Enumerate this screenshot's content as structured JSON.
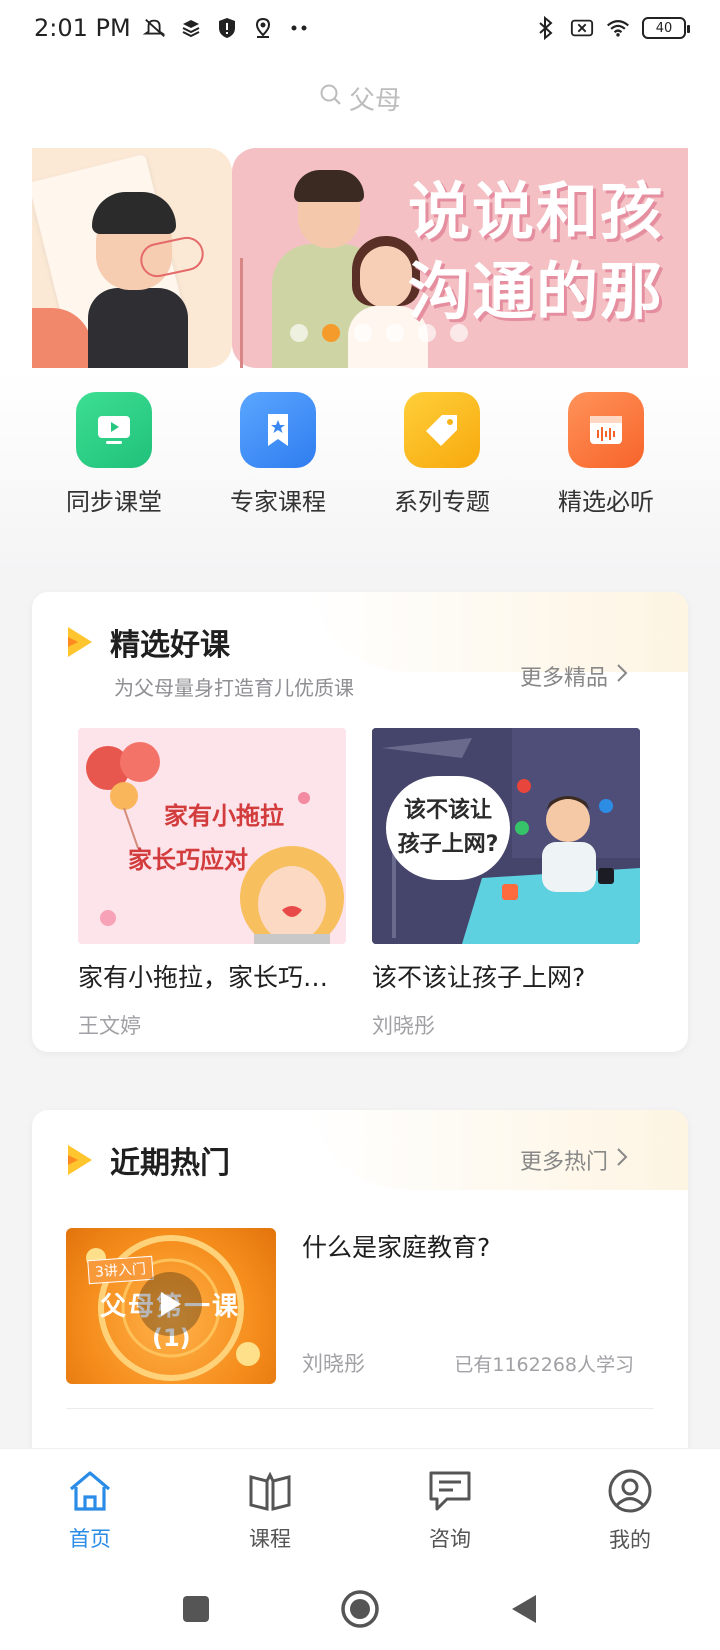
{
  "status_bar": {
    "time": "2:01 PM",
    "battery": "40",
    "left_icons": [
      "mute-icon",
      "layers-icon",
      "shield-icon",
      "location-icon",
      "more-dots-icon"
    ],
    "right_icons": [
      "bluetooth-icon",
      "no-sim-icon",
      "wifi-icon",
      "battery-icon"
    ]
  },
  "search": {
    "placeholder": "父母"
  },
  "banner": {
    "title_line1": "说说和孩",
    "title_line2": "沟通的那",
    "dot_count": 6,
    "active_dot": 1
  },
  "quick_entries": [
    {
      "label": "同步课堂",
      "icon": "tv-icon",
      "color": "#2ecf86"
    },
    {
      "label": "专家课程",
      "icon": "bookmark-star-icon",
      "color": "#3f8ff5"
    },
    {
      "label": "系列专题",
      "icon": "tag-icon",
      "color": "#f9b919"
    },
    {
      "label": "精选必听",
      "icon": "audio-window-icon",
      "color": "#fb7a3a"
    }
  ],
  "featured": {
    "title": "精选好课",
    "subtitle": "为父母量身打造育儿优质课",
    "more": "更多精品",
    "courses": [
      {
        "title": "家有小拖拉，家长巧应对",
        "author": "王文婷",
        "thumb_line1": "家有小拖拉",
        "thumb_line2": "家长巧应对"
      },
      {
        "title": "该不该让孩子上网?",
        "author": "刘晓彤",
        "thumb_line1": "该不该让",
        "thumb_line2": "孩子上网?"
      }
    ]
  },
  "hot": {
    "title": "近期热门",
    "more": "更多热门",
    "item": {
      "title": "什么是家庭教育?",
      "author": "刘晓彤",
      "count": "已有1162268人学习",
      "thumb_tag": "3讲入门",
      "thumb_title": "父母第一课",
      "thumb_sub": "(1)"
    }
  },
  "bottom_nav": [
    {
      "label": "首页",
      "icon": "home-icon",
      "active": true
    },
    {
      "label": "课程",
      "icon": "book-icon",
      "active": false
    },
    {
      "label": "咨询",
      "icon": "chat-icon",
      "active": false
    },
    {
      "label": "我的",
      "icon": "user-icon",
      "active": false
    }
  ],
  "colors": {
    "accent": "#2a8ce6",
    "dot_active": "#f59b2b"
  }
}
